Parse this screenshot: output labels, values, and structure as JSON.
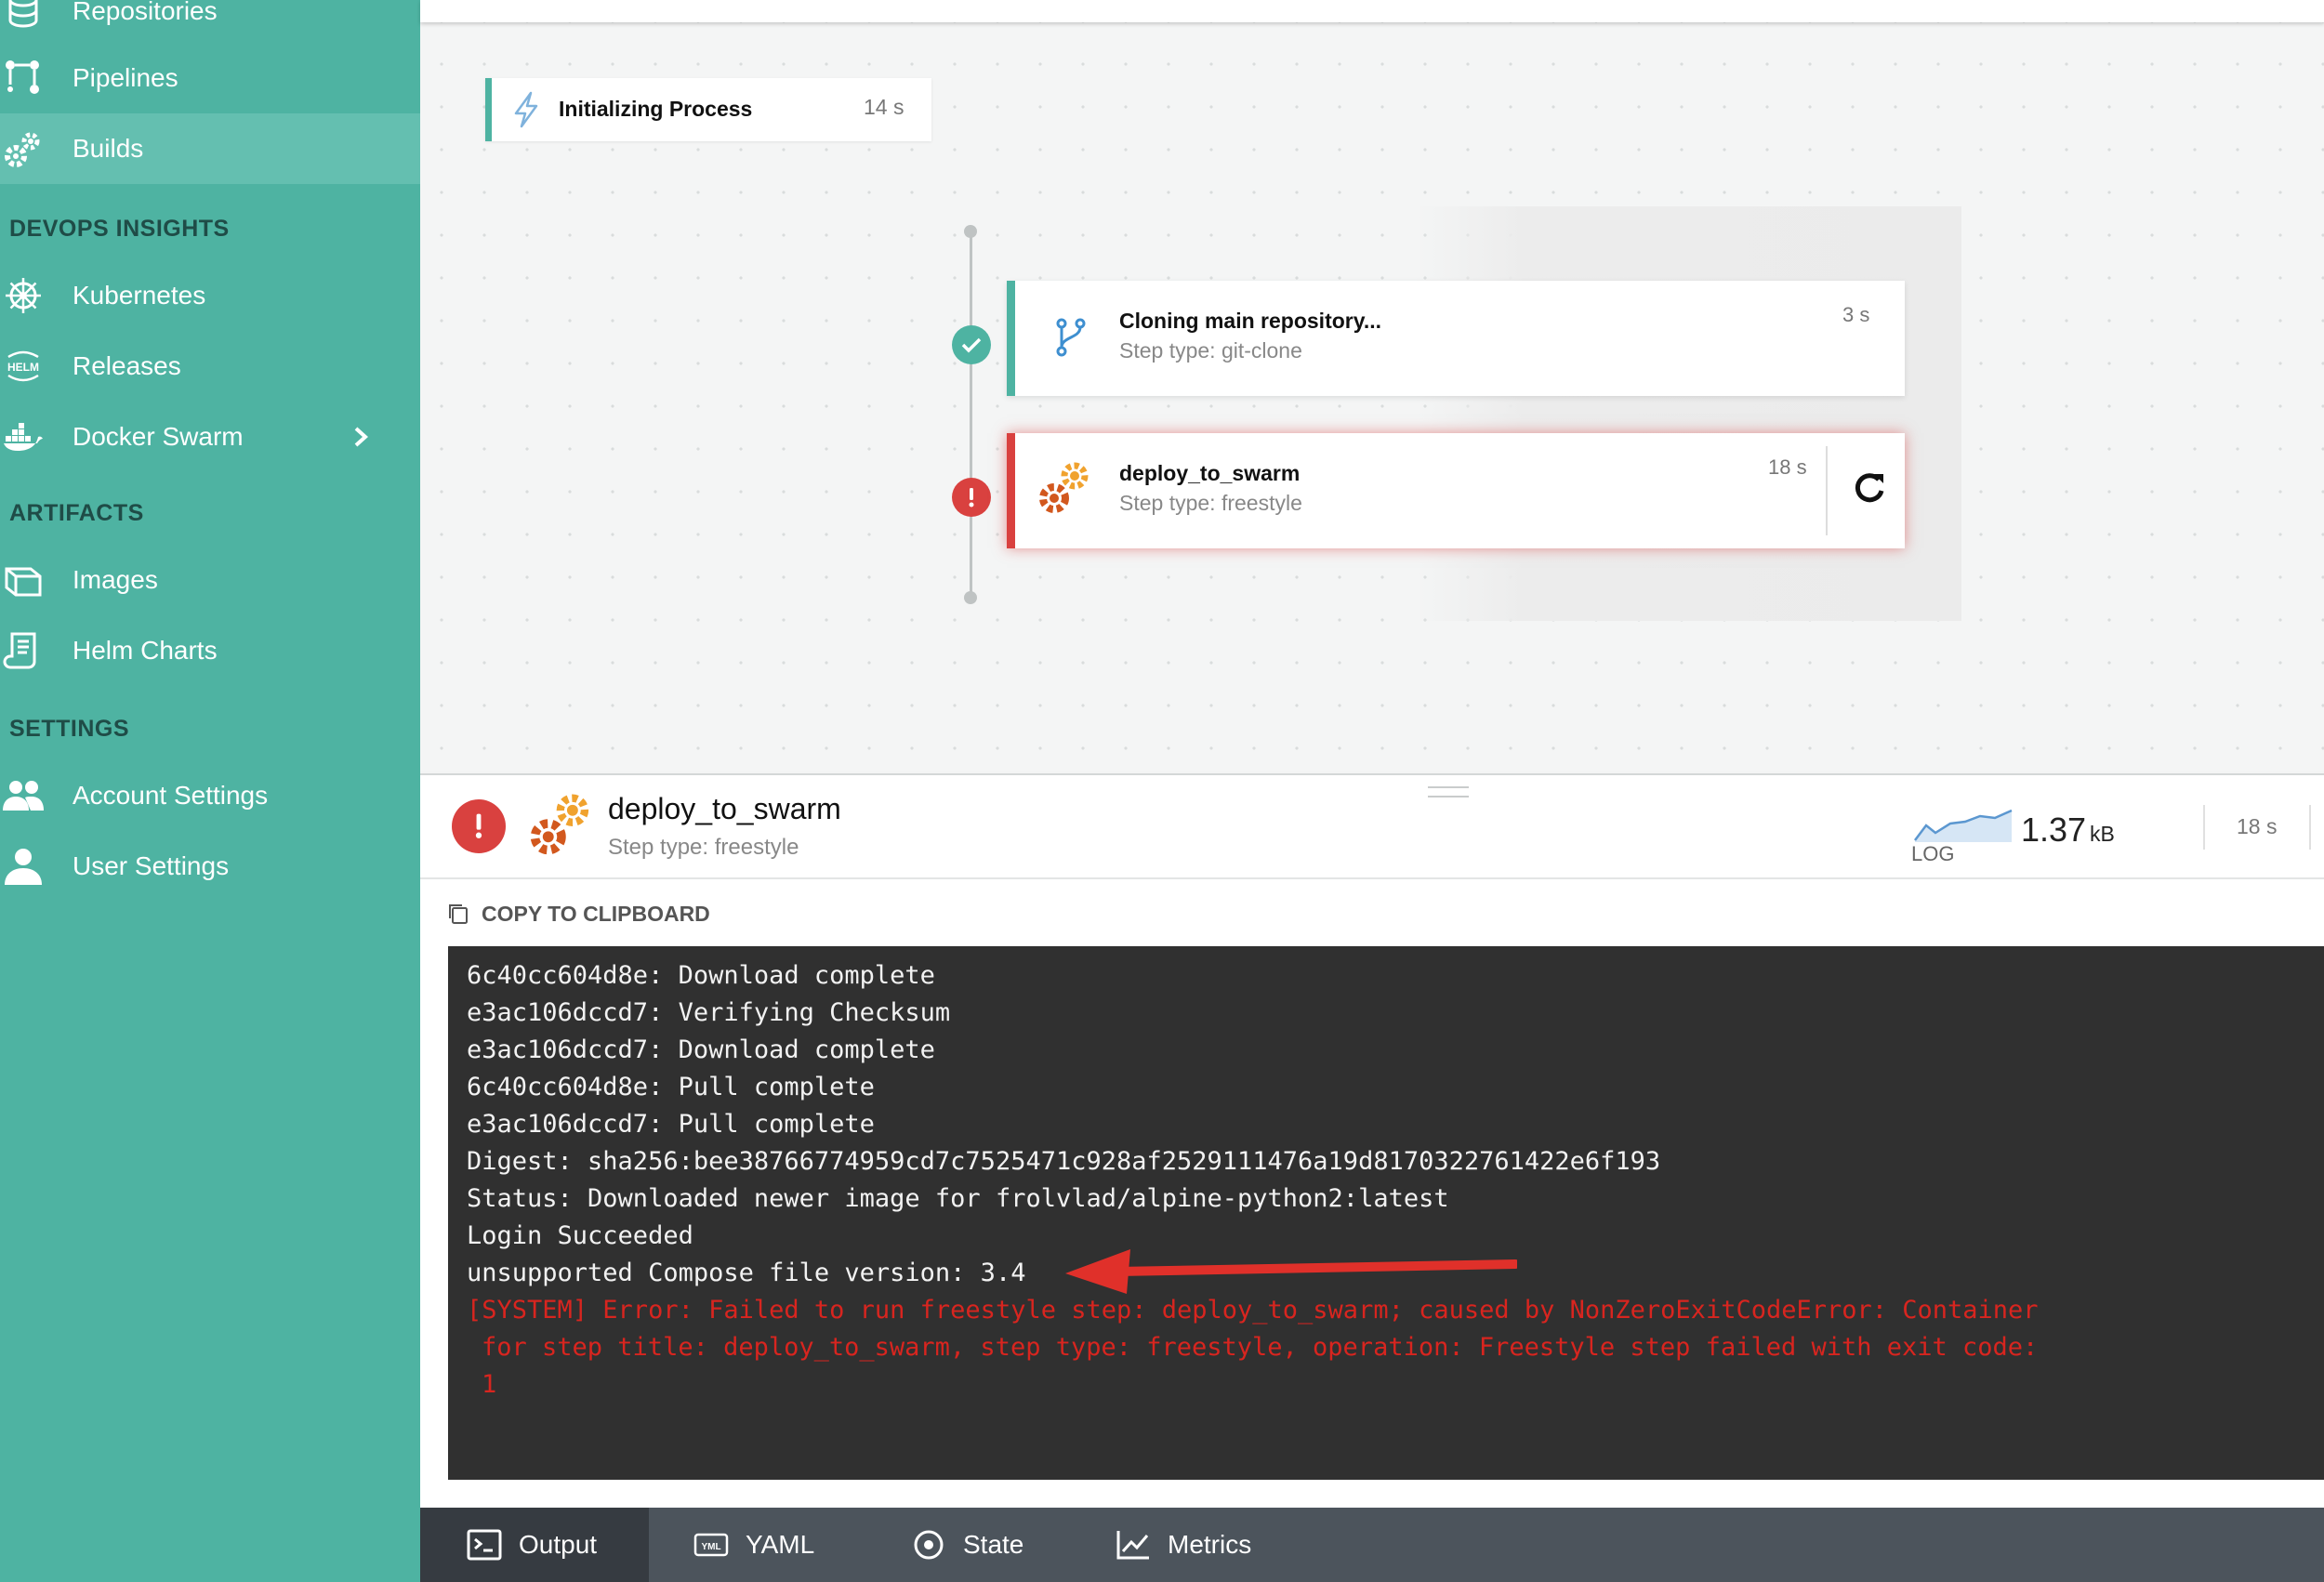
{
  "sidebar": {
    "items": [
      {
        "label": "Repositories",
        "icon": "database-icon"
      },
      {
        "label": "Pipelines",
        "icon": "pipeline-icon"
      },
      {
        "label": "Builds",
        "icon": "gears-icon",
        "active": true
      },
      {
        "label": "Kubernetes",
        "icon": "helm-wheel-icon"
      },
      {
        "label": "Releases",
        "icon": "helm-icon"
      },
      {
        "label": "Docker Swarm",
        "icon": "docker-icon"
      },
      {
        "label": "Images",
        "icon": "box-icon"
      },
      {
        "label": "Helm Charts",
        "icon": "scroll-icon"
      },
      {
        "label": "Account Settings",
        "icon": "users-icon"
      },
      {
        "label": "User Settings",
        "icon": "user-icon"
      }
    ],
    "sections": [
      "DEVOPS INSIGHTS",
      "ARTIFACTS",
      "SETTINGS"
    ],
    "helm_badge": "HELM"
  },
  "canvas": {
    "init_step": {
      "title": "Initializing Process",
      "duration": "14 s"
    },
    "steps": [
      {
        "name": "Cloning main repository...",
        "type": "Step type: git-clone",
        "duration": "3 s",
        "status": "success"
      },
      {
        "name": "deploy_to_swarm",
        "type": "Step type: freestyle",
        "duration": "18 s",
        "status": "error"
      }
    ]
  },
  "panel": {
    "title": "deploy_to_swarm",
    "subtitle": "Step type: freestyle",
    "log_label": "LOG",
    "log_size": "1.37",
    "log_unit": "kB",
    "duration": "18 s",
    "copy_label": "COPY TO CLIPBOARD"
  },
  "console": {
    "lines": [
      "6c40cc604d8e: Download complete",
      "e3ac106dccd7: Verifying Checksum",
      "e3ac106dccd7: Download complete",
      "6c40cc604d8e: Pull complete",
      "e3ac106dccd7: Pull complete",
      "Digest: sha256:bee38766774959cd7c7525471c928af2529111476a19d8170322761422e6f193",
      "Status: Downloaded newer image for frolvlad/alpine-python2:latest",
      "Login Succeeded",
      "unsupported Compose file version: 3.4"
    ],
    "error_lines": [
      "[SYSTEM] Error: Failed to run freestyle step: deploy_to_swarm; caused by NonZeroExitCodeError: Container",
      "for step title: deploy_to_swarm, step type: freestyle, operation: Freestyle step failed with exit code:",
      "1"
    ]
  },
  "tabs": [
    {
      "label": "Output",
      "icon": "terminal-icon",
      "active": true
    },
    {
      "label": "YAML",
      "icon": "yaml-icon",
      "icon_text": "YML"
    },
    {
      "label": "State",
      "icon": "target-icon"
    },
    {
      "label": "Metrics",
      "icon": "chart-line-icon"
    }
  ],
  "colors": {
    "sidebar": "#4eb3a2",
    "sidebar_active": "#64bfb0",
    "success": "#4eb3a2",
    "error": "#d9413f",
    "console_bg": "#303030",
    "console_error": "#d8251f",
    "tabbar": "#4c545c"
  }
}
